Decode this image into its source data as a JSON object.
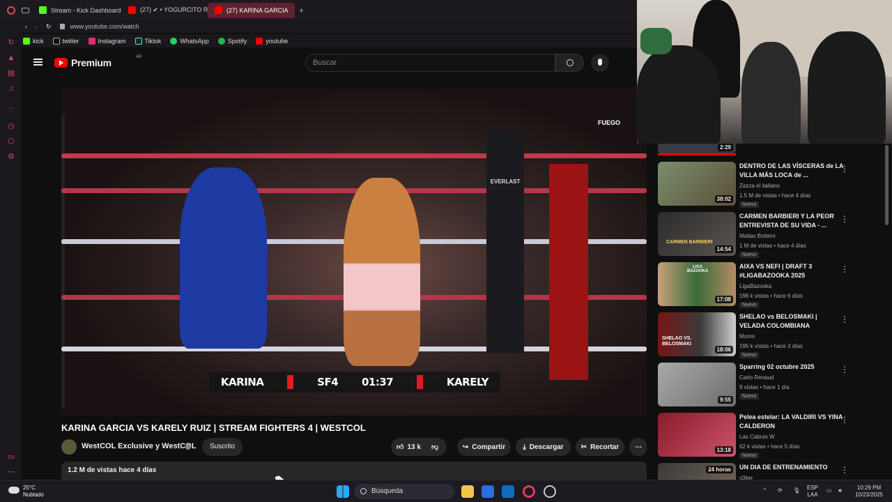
{
  "browser": {
    "tabs": [
      {
        "label": "Stream - Kick Dashboard",
        "color": "#53fc18"
      },
      {
        "label": "(27) ✔ • YOGURCITO R",
        "color": "#ff0000"
      },
      {
        "label": "(27) KARINA GARCIA",
        "color": "#ff0000"
      }
    ],
    "new_tab": "+",
    "url": "www.youtube.com/watch",
    "bookmarks": [
      {
        "label": "kick",
        "color": "#53fc18"
      },
      {
        "label": "twitter",
        "color": "#ffffff"
      },
      {
        "label": "Instagram",
        "color": "#e1306c"
      },
      {
        "label": "Tiktok",
        "color": "#ffffff"
      },
      {
        "label": "WhatsApp",
        "color": "#25d366"
      },
      {
        "label": "Spotify",
        "color": "#1db954"
      },
      {
        "label": "youtube",
        "color": "#ff0000"
      }
    ],
    "sidebar_bottom": "GX"
  },
  "youtube": {
    "logo": "Premium",
    "logo_region": "AR",
    "search_placeholder": "Buscar",
    "video": {
      "score_left": "KARINA",
      "score_logo": "SF4",
      "score_clock": "01:37",
      "score_right": "KARELY",
      "watermark": "FUEGO",
      "ring_brand": "EVERLAST"
    },
    "title": "KARINA GARCIA VS KARELY RUIZ | STREAM FIGHTERS 4 | WESTCOL",
    "channel": "WestCOL Exclusive y WestCOL",
    "subscribe": "Suscrito",
    "likes": "13 k",
    "share": "Compartir",
    "download": "Descargar",
    "clip": "Recortar",
    "views": "1.2 M de vistas  hace 4 días"
  },
  "related": [
    {
      "title": "",
      "channel": "",
      "meta": "",
      "duration": "2:29",
      "new": ""
    },
    {
      "title": "DENTRO DE LAS VÍSCERAS de LA VILLA MÁS LOCA de ...",
      "channel": "Zazza el italiano",
      "meta": "1.5 M de vistas • hace 4 días",
      "duration": "38:02",
      "new": "Nuevo"
    },
    {
      "title": "CARMEN BARBIERI Y LA PEOR ENTREVISTA DE SU VIDA - ...",
      "channel": "Matias Bottero",
      "meta": "1 M de vistas • hace 4 días",
      "duration": "14:54",
      "new": "Nuevo"
    },
    {
      "title": "AIXA VS NEFI | DRAFT 3 #LIGABAZOOKA 2025",
      "channel": "LigaBazooka",
      "meta": "196 k vistas • hace 6 días",
      "duration": "17:08",
      "new": "Nuevo"
    },
    {
      "title": "SHELAO vs BELOSMAKI | VELADA COLOMBIANA",
      "channel": "Momo",
      "meta": "195 k vistas • hace 3 días",
      "duration": "18:06",
      "new": "Nuevo"
    },
    {
      "title": "Sparring 02 octubre 2025",
      "channel": "Carlo Renaud",
      "meta": "9 vistas • hace 1 día",
      "duration": "9:55",
      "new": "Nuevo"
    },
    {
      "title": "Pelea estelar: LA VALDIRI VS YINA CALDERON",
      "channel": "Las Cabras W",
      "meta": "62 k vistas • hace 5 días",
      "duration": "13:18",
      "new": "Nuevo"
    },
    {
      "title": "UN DIA DE ENTRENAMIENTO",
      "channel": "c0ker",
      "meta": "",
      "duration": "24 horas",
      "new": ""
    }
  ],
  "thumb_text": {
    "carmen": "CARMEN BARBIERI",
    "shelao": "SHELAO VS. BELOSMAKI",
    "liga": "LIGA BAZOOKA"
  },
  "taskbar": {
    "weather_temp": "25°C",
    "weather_desc": "Nublado",
    "search": "Búsqueda",
    "lang1": "ESP",
    "lang2": "LAA",
    "time": "10:29 PM",
    "date": "10/23/2025"
  }
}
